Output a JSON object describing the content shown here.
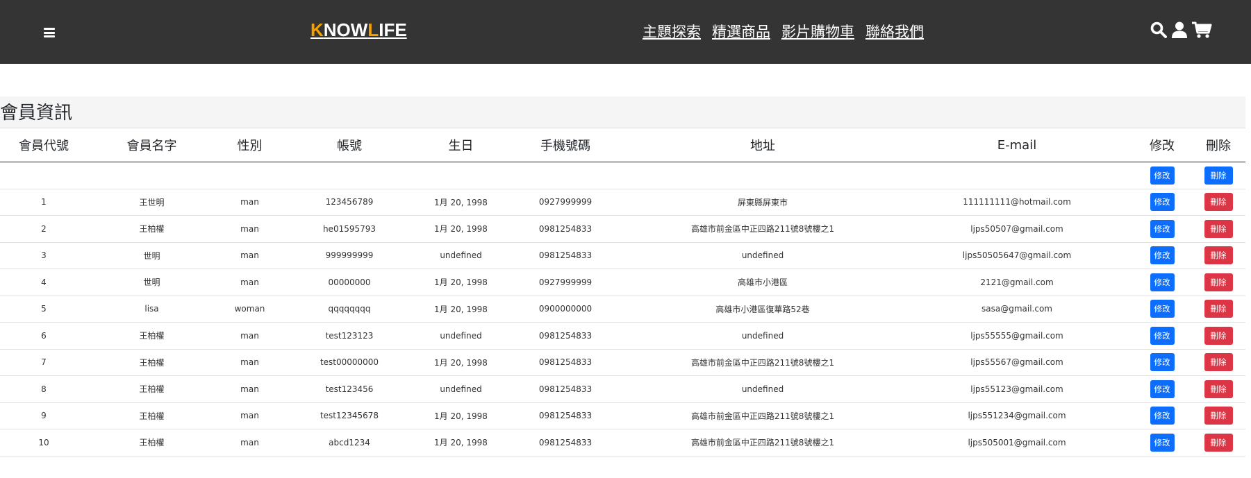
{
  "brand": {
    "first": "K",
    "part1": "NOW",
    "accent2": "L",
    "part2": "IFE"
  },
  "nav": [
    "主題探索",
    "精選商品",
    "影片購物車",
    "聯絡我們"
  ],
  "icons": [
    "search-icon",
    "user-icon",
    "cart-icon"
  ],
  "page_title": "會員資訊",
  "columns": [
    "會員代號",
    "會員名字",
    "性別",
    "帳號",
    "生日",
    "手機號碼",
    "地址",
    "E-mail",
    "修改",
    "刪除"
  ],
  "buttons": {
    "edit": "修改",
    "delete": "刪除"
  },
  "rows": [
    [
      "1",
      "王世明",
      "man",
      "123456789",
      "1月 20, 1998",
      "0927999999",
      "屏東縣屏東市",
      "111111111@hotmail.com"
    ],
    [
      "2",
      "王柏權",
      "man",
      "he01595793",
      "1月 20, 1998",
      "0981254833",
      "高雄市前金區中正四路211號8號樓之1",
      "ljps50507@gmail.com"
    ],
    [
      "3",
      "世明",
      "man",
      "999999999",
      "undefined",
      "0981254833",
      "undefined",
      "ljps50505647@gmail.com"
    ],
    [
      "4",
      "世明",
      "man",
      "00000000",
      "1月 20, 1998",
      "0927999999",
      "高雄市小港區",
      "2121@gmail.com"
    ],
    [
      "5",
      "lisa",
      "woman",
      "qqqqqqqq",
      "1月 20, 1998",
      "0900000000",
      "高雄市小港區復華路52巷",
      "sasa@gmail.com"
    ],
    [
      "6",
      "王柏權",
      "man",
      "test123123",
      "undefined",
      "0981254833",
      "undefined",
      "ljps55555@gmail.com"
    ],
    [
      "7",
      "王柏權",
      "man",
      "test00000000",
      "1月 20, 1998",
      "0981254833",
      "高雄市前金區中正四路211號8號樓之1",
      "ljps55567@gmail.com"
    ],
    [
      "8",
      "王柏權",
      "man",
      "test123456",
      "undefined",
      "0981254833",
      "undefined",
      "ljps55123@gmail.com"
    ],
    [
      "9",
      "王柏權",
      "man",
      "test12345678",
      "1月 20, 1998",
      "0981254833",
      "高雄市前金區中正四路211號8號樓之1",
      "ljps551234@gmail.com"
    ],
    [
      "10",
      "王柏權",
      "man",
      "abcd1234",
      "1月 20, 1998",
      "0981254833",
      "高雄市前金區中正四路211號8號樓之1",
      "ljps505001@gmail.com"
    ]
  ],
  "colors": {
    "navbar": "#343434",
    "accent": "#f5a000",
    "edit": "#0d6efd",
    "delete": "#dc3545"
  }
}
